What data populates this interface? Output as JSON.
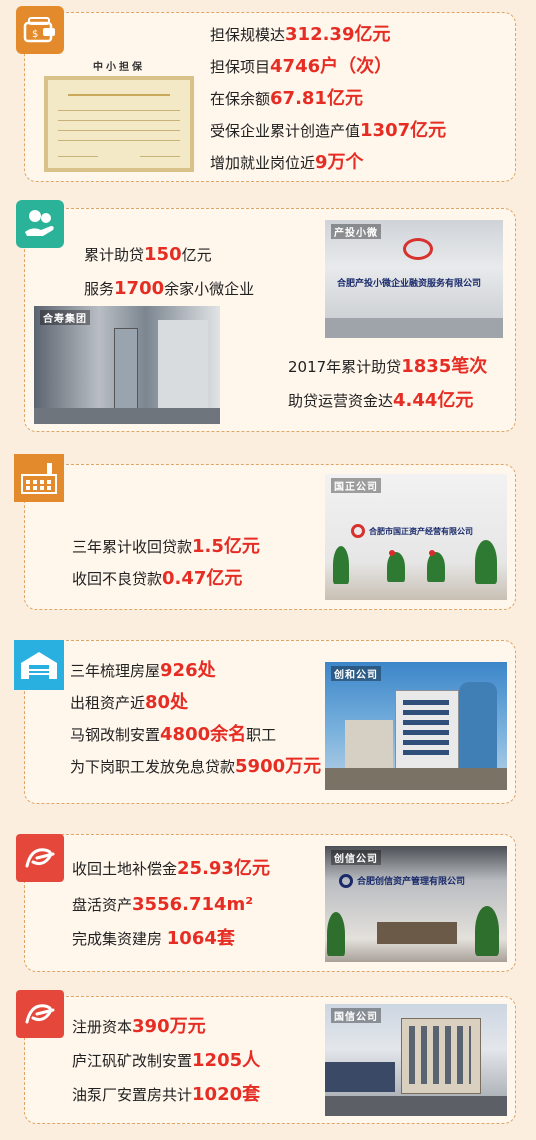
{
  "colors": {
    "orange": "#e38b2c",
    "teal": "#2bb39a",
    "blue": "#29b0e0",
    "red": "#e5473a",
    "highlight": "#e62d24"
  },
  "panel1": {
    "icon": "wallet-icon",
    "cert_title": "中小担保",
    "lines": [
      {
        "pre": "担保规模达",
        "hl": "312.39亿元",
        "post": ""
      },
      {
        "pre": "担保项目",
        "hl": "4746户（次）",
        "post": ""
      },
      {
        "pre": "在保余额",
        "hl": "67.81亿元",
        "post": ""
      },
      {
        "pre": "受保企业累计创造产值",
        "hl": "1307亿元",
        "post": ""
      },
      {
        "pre": "增加就业岗位近",
        "hl": "9万个",
        "post": ""
      }
    ]
  },
  "panel2": {
    "icon": "money-hand-icon",
    "photo1_tag": "产投小微",
    "photo1_sign": "合肥产投小微企业融资服务有限公司",
    "photo2_tag": "合寿集团",
    "lines": [
      {
        "pre": "累计助贷",
        "hl": "150",
        "post": "亿元"
      },
      {
        "pre": "服务",
        "hl": "1700",
        "post": "余家小微企业"
      },
      {
        "pre": "2017年累计助贷",
        "hl": "1835笔次",
        "post": ""
      },
      {
        "pre": "助贷运营资金达",
        "hl": "4.44亿元",
        "post": ""
      }
    ]
  },
  "panel3": {
    "icon": "factory-icon",
    "photo_tag": "国正公司",
    "photo_sign": "合肥市国正资产经营有限公司",
    "lines": [
      {
        "pre": "三年累计收回贷款",
        "hl": "1.5亿元",
        "post": ""
      },
      {
        "pre": "收回不良贷款",
        "hl": "0.47亿元",
        "post": ""
      }
    ]
  },
  "panel4": {
    "icon": "warehouse-icon",
    "photo_tag": "创和公司",
    "lines": [
      {
        "pre": "三年梳理房屋",
        "hl": "926处",
        "post": ""
      },
      {
        "pre": "出租资产近",
        "hl": "80处",
        "post": ""
      },
      {
        "pre": "马钢改制安置",
        "hl": "4800余名",
        "post": "职工"
      },
      {
        "pre": "为下岗职工发放免息贷款",
        "hl": "5900万元",
        "post": ""
      }
    ]
  },
  "panel5": {
    "icon": "swirl-icon",
    "photo_tag": "创信公司",
    "photo_sign": "合肥创信资产管理有限公司",
    "lines": [
      {
        "pre": "收回土地补偿金",
        "hl": "25.93亿元",
        "post": ""
      },
      {
        "pre": "盘活资产",
        "hl": "3556.714m²",
        "post": ""
      },
      {
        "pre": "完成集资建房 ",
        "hl": "1064套",
        "post": ""
      }
    ]
  },
  "panel6": {
    "icon": "swirl-icon",
    "photo_tag": "国信公司",
    "lines": [
      {
        "pre": "注册资本",
        "hl": "390万元",
        "post": ""
      },
      {
        "pre": "庐江矾矿改制安置",
        "hl": "1205人",
        "post": ""
      },
      {
        "pre": "油泵厂安置房共计",
        "hl": "1020套",
        "post": ""
      }
    ]
  }
}
